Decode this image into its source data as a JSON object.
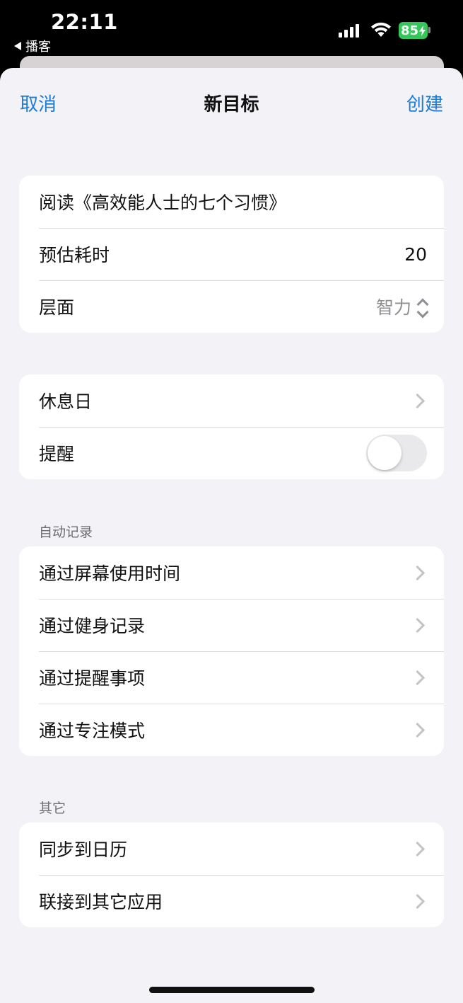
{
  "status_bar": {
    "time": "22:11",
    "back_app": "播客",
    "battery": "85"
  },
  "nav": {
    "cancel": "取消",
    "title": "新目标",
    "create": "创建"
  },
  "goal_group": {
    "name": "阅读《高效能人士的七个习惯》",
    "duration_label": "预估耗时",
    "duration_value": "20",
    "aspect_label": "层面",
    "aspect_value": "智力"
  },
  "schedule_group": {
    "rest_days": "休息日",
    "reminder": "提醒",
    "reminder_on": false
  },
  "auto_record": {
    "header": "自动记录",
    "items": [
      "通过屏幕使用时间",
      "通过健身记录",
      "通过提醒事项",
      "通过专注模式"
    ]
  },
  "other": {
    "header": "其它",
    "items": [
      "同步到日历",
      "联接到其它应用"
    ]
  },
  "colors": {
    "accent": "#1e7cd6",
    "battery": "#34c759",
    "background": "#f2f2f7"
  }
}
